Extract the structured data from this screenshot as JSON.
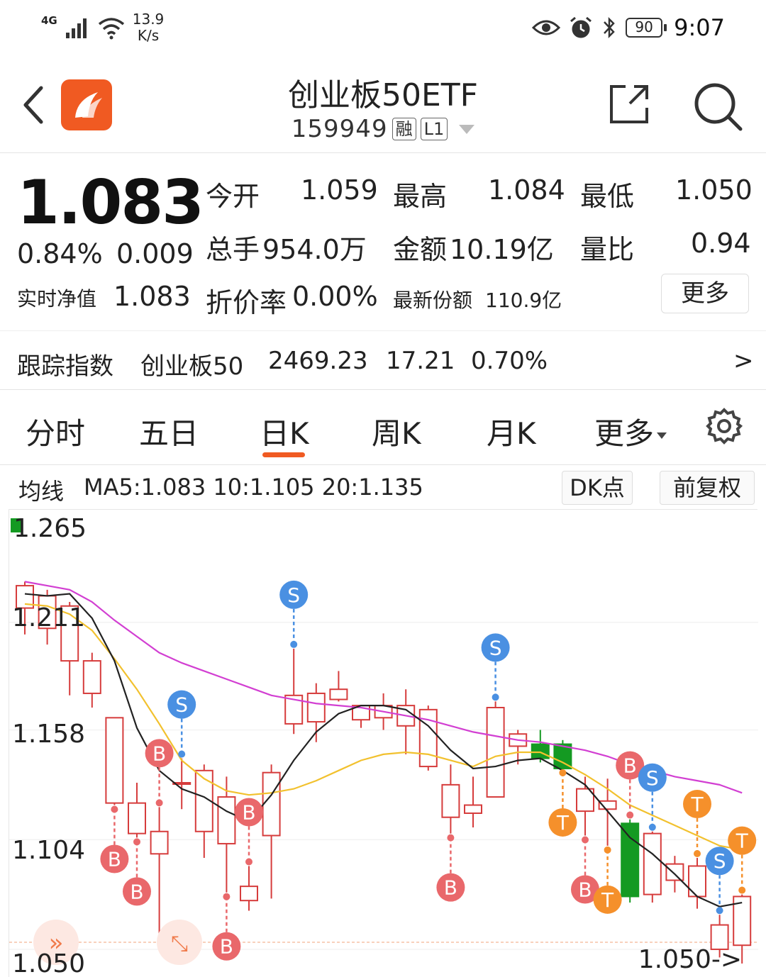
{
  "status_bar": {
    "network": "4G",
    "speed_value": "13.9",
    "speed_unit": "K/s",
    "battery": "90",
    "time": "9:07",
    "icons": [
      "signal-icon",
      "wifi-icon",
      "eye-icon",
      "alarm-icon",
      "bluetooth-icon",
      "battery-icon"
    ]
  },
  "header": {
    "title": "创业板50ETF",
    "code": "159949",
    "tag_margin": "融",
    "tag_level": "L1"
  },
  "quote": {
    "price": "1.083",
    "change_pct": "0.84%",
    "change": "0.009",
    "open_label": "今开",
    "open": "1.059",
    "high_label": "最高",
    "high": "1.084",
    "low_label": "最低",
    "low": "1.050",
    "volume_label": "总手",
    "volume": "954.0万",
    "amount_label": "金额",
    "amount": "10.19亿",
    "ratio_label": "量比",
    "ratio": "0.94",
    "nav_label": "实时净值",
    "nav": "1.083",
    "discount_label": "折价率",
    "discount": "0.00%",
    "shares_label": "最新份额",
    "shares": "110.9亿",
    "more": "更多"
  },
  "index": {
    "label": "跟踪指数",
    "name": "创业板50",
    "value": "2469.23",
    "change": "17.21",
    "pct": "0.70%",
    "arrow": ">"
  },
  "tabs": [
    "分时",
    "五日",
    "日K",
    "周K",
    "月K",
    "更多"
  ],
  "active_tab": "日K",
  "ma": {
    "label": "均线",
    "values": "MA5:1.083 10:1.105 20:1.135",
    "dk_button": "DK点",
    "adjust_button": "前复权"
  },
  "chart_data": {
    "type": "candlestick",
    "y_ticks": [
      "1.211",
      "1.158",
      "1.104",
      "1.050"
    ],
    "ylim": [
      1.05,
      1.265
    ],
    "max_note": "1.265",
    "min_note": "1.050->",
    "colors": {
      "up": "#d63c3c",
      "down": "#149a22",
      "ma5": "#222222",
      "ma10": "#f2c12e",
      "ma20": "#d23fd2",
      "buy": "#e9686b",
      "sell": "#4a90e2",
      "t": "#f5902b"
    },
    "candles": [
      {
        "o": 1.225,
        "c": 1.236,
        "h": 1.238,
        "l": 1.212
      },
      {
        "o": 1.215,
        "c": 1.231,
        "h": 1.234,
        "l": 1.207
      },
      {
        "o": 1.199,
        "c": 1.226,
        "h": 1.228,
        "l": 1.182
      },
      {
        "o": 1.183,
        "c": 1.199,
        "h": 1.203,
        "l": 1.176
      },
      {
        "o": 1.129,
        "c": 1.171,
        "h": 1.171,
        "l": 1.128
      },
      {
        "o": 1.114,
        "c": 1.129,
        "h": 1.139,
        "l": 1.112
      },
      {
        "o": 1.104,
        "c": 1.115,
        "h": 1.127,
        "l": 1.058
      },
      {
        "o": 1.139,
        "c": 1.139,
        "h": 1.151,
        "l": 1.126
      },
      {
        "o": 1.115,
        "c": 1.145,
        "h": 1.148,
        "l": 1.102
      },
      {
        "o": 1.109,
        "c": 1.132,
        "h": 1.142,
        "l": 1.085
      },
      {
        "o": 1.081,
        "c": 1.088,
        "h": 1.098,
        "l": 1.076
      },
      {
        "o": 1.113,
        "c": 1.144,
        "h": 1.148,
        "l": 1.082
      },
      {
        "o": 1.168,
        "c": 1.182,
        "h": 1.205,
        "l": 1.163
      },
      {
        "o": 1.169,
        "c": 1.183,
        "h": 1.188,
        "l": 1.159
      },
      {
        "o": 1.18,
        "c": 1.185,
        "h": 1.194,
        "l": 1.179
      },
      {
        "o": 1.17,
        "c": 1.177,
        "h": 1.175,
        "l": 1.166
      },
      {
        "o": 1.171,
        "c": 1.177,
        "h": 1.183,
        "l": 1.165
      },
      {
        "o": 1.167,
        "c": 1.177,
        "h": 1.185,
        "l": 1.153
      },
      {
        "o": 1.147,
        "c": 1.175,
        "h": 1.177,
        "l": 1.145
      },
      {
        "o": 1.122,
        "c": 1.138,
        "h": 1.148,
        "l": 1.114
      },
      {
        "o": 1.124,
        "c": 1.128,
        "h": 1.142,
        "l": 1.117
      },
      {
        "o": 1.132,
        "c": 1.176,
        "h": 1.179,
        "l": 1.132
      },
      {
        "o": 1.157,
        "c": 1.163,
        "h": 1.165,
        "l": 1.148
      },
      {
        "o": 1.158,
        "c": 1.151,
        "h": 1.165,
        "l": 1.149
      },
      {
        "o": 1.158,
        "c": 1.146,
        "h": 1.16,
        "l": 1.146
      },
      {
        "o": 1.125,
        "c": 1.136,
        "h": 1.142,
        "l": 1.113
      },
      {
        "o": 1.126,
        "c": 1.13,
        "h": 1.141,
        "l": 1.108
      },
      {
        "o": 1.119,
        "c": 1.083,
        "h": 1.121,
        "l": 1.08
      },
      {
        "o": 1.084,
        "c": 1.114,
        "h": 1.115,
        "l": 1.08
      },
      {
        "o": 1.091,
        "c": 1.099,
        "h": 1.103,
        "l": 1.085
      },
      {
        "o": 1.083,
        "c": 1.098,
        "h": 1.102,
        "l": 1.077
      },
      {
        "o": 1.057,
        "c": 1.069,
        "h": 1.074,
        "l": 1.053
      },
      {
        "o": 1.059,
        "c": 1.083,
        "h": 1.084,
        "l": 1.05
      }
    ],
    "ma5": [
      1.232,
      1.231,
      1.232,
      1.22,
      1.199,
      1.166,
      1.145,
      1.136,
      1.132,
      1.125,
      1.12,
      1.133,
      1.15,
      1.164,
      1.173,
      1.177,
      1.177,
      1.175,
      1.167,
      1.155,
      1.146,
      1.147,
      1.15,
      1.151,
      1.145,
      1.138,
      1.125,
      1.112,
      1.104,
      1.094,
      1.083,
      1.078,
      1.08
    ],
    "ma10": [
      1.227,
      1.226,
      1.222,
      1.214,
      1.2,
      1.185,
      1.168,
      1.15,
      1.141,
      1.135,
      1.133,
      1.134,
      1.136,
      1.14,
      1.145,
      1.15,
      1.153,
      1.154,
      1.153,
      1.15,
      1.147,
      1.152,
      1.154,
      1.154,
      1.149,
      1.143,
      1.136,
      1.128,
      1.123,
      1.118,
      1.113,
      1.108,
      1.106
    ],
    "ma20": [
      1.238,
      1.236,
      1.234,
      1.228,
      1.219,
      1.211,
      1.203,
      1.198,
      1.194,
      1.19,
      1.186,
      1.182,
      1.18,
      1.178,
      1.177,
      1.176,
      1.174,
      1.172,
      1.17,
      1.167,
      1.164,
      1.162,
      1.16,
      1.159,
      1.157,
      1.155,
      1.152,
      1.148,
      1.145,
      1.142,
      1.14,
      1.138,
      1.134
    ],
    "signals": [
      {
        "i": 4,
        "type": "B",
        "dir": "down"
      },
      {
        "i": 5,
        "type": "B",
        "dir": "down"
      },
      {
        "i": 6,
        "type": "B",
        "dir": "up"
      },
      {
        "i": 7,
        "type": "S",
        "dir": "up"
      },
      {
        "i": 9,
        "type": "B",
        "dir": "down"
      },
      {
        "i": 10,
        "type": "B",
        "dir": "up"
      },
      {
        "i": 12,
        "type": "S",
        "dir": "up"
      },
      {
        "i": 19,
        "type": "B",
        "dir": "down"
      },
      {
        "i": 21,
        "type": "S",
        "dir": "up"
      },
      {
        "i": 24,
        "type": "T",
        "dir": "down"
      },
      {
        "i": 25,
        "type": "B",
        "dir": "down"
      },
      {
        "i": 26,
        "type": "T",
        "dir": "down"
      },
      {
        "i": 27,
        "type": "B",
        "dir": "up"
      },
      {
        "i": 28,
        "type": "S",
        "dir": "up"
      },
      {
        "i": 30,
        "type": "T",
        "dir": "up"
      },
      {
        "i": 31,
        "type": "S",
        "dir": "up"
      },
      {
        "i": 32,
        "type": "T",
        "dir": "up"
      }
    ]
  }
}
